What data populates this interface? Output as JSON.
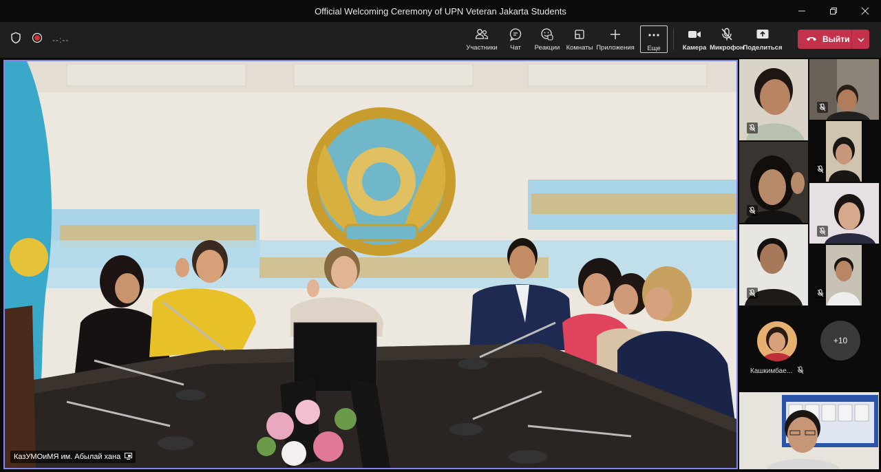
{
  "window": {
    "title": "Official Welcoming Ceremony of UPN Veteran Jakarta Students",
    "minimize_icon": "minimize-icon",
    "restore_icon": "restore-icon",
    "close_icon": "close-icon"
  },
  "toolbar": {
    "timer": "--:--",
    "buttons": [
      {
        "label": "Участники",
        "icon": "people-icon"
      },
      {
        "label": "Чат",
        "icon": "chat-icon"
      },
      {
        "label": "Реакции",
        "icon": "reaction-icon"
      },
      {
        "label": "Комнаты",
        "icon": "breakout-rooms-icon"
      },
      {
        "label": "Приложения",
        "icon": "plus-icon"
      },
      {
        "label": "Еще",
        "icon": "more-icon"
      },
      {
        "label": "Камера",
        "icon": "camera-icon"
      },
      {
        "label": "Микрофон",
        "icon": "mic-off-icon"
      },
      {
        "label": "Поделиться",
        "icon": "share-icon"
      }
    ],
    "leave_label": "Выйти"
  },
  "stage": {
    "speaker_name": "КазУМОиМЯ им. Абылай хана"
  },
  "sidebar": {
    "participant_name": "Кашкимбае...",
    "overflow_count": "+10"
  },
  "colors": {
    "accent": "#7f85f5",
    "leave": "#c4314b",
    "toolbar_bg": "#1f1f1f"
  }
}
